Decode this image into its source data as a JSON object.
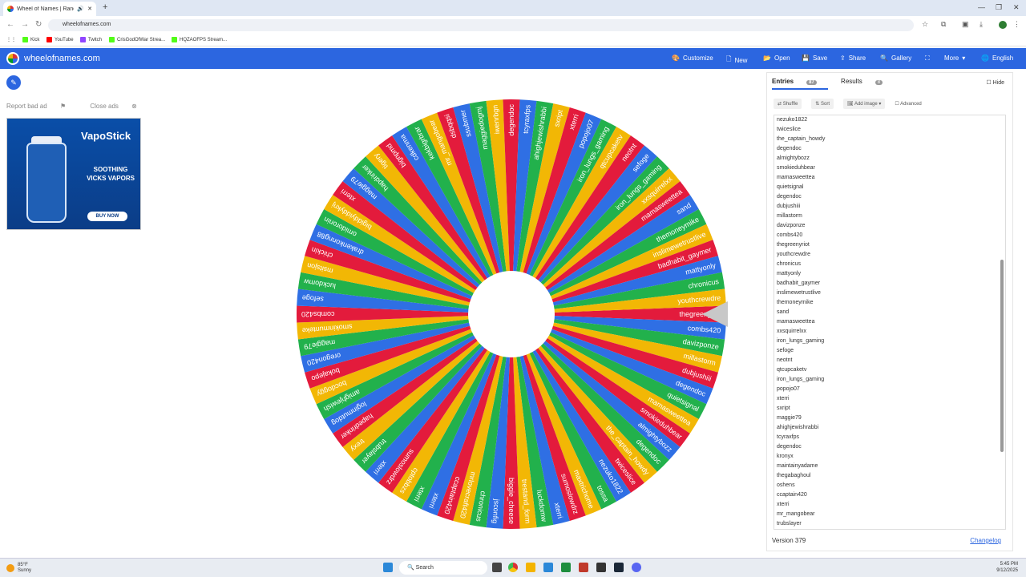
{
  "browser": {
    "tab_title": "Wheel of Names | Random",
    "url": "wheelofnames.com",
    "bookmarks": [
      "Kick",
      "YouTube",
      "Twitch",
      "CrisGodOfWar Strea...",
      "HQZAOFPS Stream..."
    ]
  },
  "header": {
    "site_name": "wheelofnames.com",
    "menu": [
      "Customize",
      "New",
      "Open",
      "Save",
      "Share",
      "Gallery",
      "More",
      "English"
    ]
  },
  "ad_links": {
    "report": "Report bad ad",
    "close": "Close ads"
  },
  "ad": {
    "brand": "VapoStick",
    "copy": "SOOTHING VICKS VAPORS",
    "cta": "BUY NOW"
  },
  "panel": {
    "tab_entries": "Entries",
    "entries_count": "87",
    "tab_results": "Results",
    "results_count": "8",
    "hide_label": "Hide",
    "tools": [
      "Shuffle",
      "Sort",
      "Add image",
      "Advanced"
    ],
    "entries": [
      "nezuko1822",
      "twiceslice",
      "the_captain_howdy",
      "degendoc",
      "almightybozz",
      "smokieduhbear",
      "mamasweettea",
      "quietsignal",
      "degendoc",
      "dubjushiii",
      "millastorm",
      "davizponze",
      "combs420",
      "thegreenyriot",
      "youthcrewdre",
      "chronicus",
      "mattyonly",
      "badhabit_gaymer",
      "inslimewetrustlive",
      "themoneymike",
      "sand",
      "mamasweettea",
      "xxsquirrelxx",
      "iron_lungs_gaming",
      "sefoge",
      "neotnt",
      "qtcupcaketv",
      "iron_lungs_gaming",
      "popojo07",
      "xterri",
      "sxript",
      "maggie79",
      "ahighjewishrabbi",
      "tcyraxfps",
      "degendoc",
      "kronyx",
      "maintainyadame",
      "thegabaghoul",
      "oshens",
      "ccaptain420",
      "xterri",
      "mr_mangobear",
      "trubslayer"
    ],
    "version": "Version 379",
    "changelog": "Changelog"
  },
  "wheel": {
    "colors": [
      "#e31b3c",
      "#2f6fe4",
      "#22b14c",
      "#f2b705"
    ],
    "labels": [
      "thegreenyriot",
      "combs420",
      "davizponze",
      "millastorm",
      "dubjushiii",
      "degendoc",
      "quietsignal",
      "mamasweettea",
      "smokieduhbear",
      "almightybozz",
      "degendoc",
      "the_captain_howdy",
      "twiceslice",
      "nezuko1822",
      "tossa",
      "maxtrichome",
      "sumoslowdrz",
      "xterri",
      "luckdomw",
      "trestand_form",
      "biggie_cheese",
      "jsconfig",
      "chronicus",
      "mrlovecraft420",
      "ccaptain420",
      "xterri",
      "xterri",
      "cptobbzs",
      "sumoslowdrz",
      "xterri",
      "trubslayer",
      "trexy",
      "hapedrinker",
      "loginmutdog",
      "amighjewish",
      "bocdoggy",
      "bokajepo",
      "oregon420",
      "maggie79",
      "smokinmunteke",
      "combs420",
      "sefoge",
      "luckdomw",
      "msitsjon",
      "chickin",
      "drakenkonng88",
      "omidoronin",
      "bigiddyiddyknj",
      "xterri",
      "maggie79",
      "hapdrinker",
      "tigery",
      "bignpmd",
      "cdkenma",
      "kekbigrbrar",
      "mr_mangobear",
      "dsbqqsi",
      "ssubmer",
      "maggiedogmj",
      "iwenrbgn",
      "degendoc",
      "tcyraxfps",
      "ahighjewishrabbi",
      "sxript",
      "xterri",
      "popojo07",
      "iron_lungs_gaming",
      "qtcupcaketv",
      "neotnt",
      "sefoge",
      "iron_lungs_gaming",
      "xxsquirrelxx",
      "mamasweettea",
      "sand",
      "themoneymike",
      "inslimewetrustlive",
      "badhabit_gaymer",
      "mattyonly",
      "chronicus",
      "youthcrewdre"
    ]
  },
  "taskbar": {
    "temp": "85°F",
    "cond": "Sunny",
    "search": "Search",
    "time": "5:45 PM",
    "date": "9/12/2025"
  }
}
